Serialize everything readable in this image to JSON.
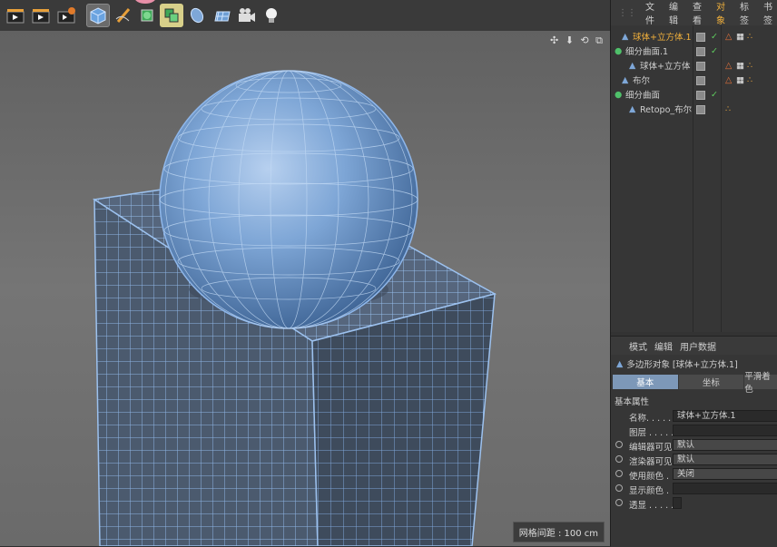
{
  "object_manager": {
    "menu": [
      "文件",
      "编辑",
      "查看",
      "对象",
      "标签",
      "书签"
    ],
    "active_menu": "对象",
    "objects": [
      {
        "name": "球体+立方体.1",
        "icon": "polygon-object-icon",
        "selected": true,
        "visible": "check",
        "tags": [
          "phong-tag-icon",
          "checker-tag-icon",
          "dots-tag-icon"
        ]
      },
      {
        "name": "细分曲面.1",
        "icon": "subdivision-surface-icon",
        "selected": false,
        "visible": "check",
        "tags": []
      },
      {
        "name": "球体+立方体",
        "icon": "polygon-object-icon",
        "selected": false,
        "visible": "",
        "tags": [
          "phong-tag-icon",
          "checker-tag-icon",
          "dots-tag-icon"
        ]
      },
      {
        "name": "布尔",
        "icon": "boole-icon",
        "selected": false,
        "visible": "",
        "tags": [
          "phong-tag-icon",
          "checker-tag-icon",
          "dots-tag-icon"
        ]
      },
      {
        "name": "细分曲面",
        "icon": "subdivision-surface-icon",
        "selected": false,
        "visible": "check",
        "tags": []
      },
      {
        "name": "Retopo_布尔",
        "icon": "polygon-object-icon",
        "selected": false,
        "visible": "",
        "tags": [
          "dots-tag-icon"
        ]
      }
    ]
  },
  "attributes": {
    "menu": [
      "模式",
      "编辑",
      "用户数据"
    ],
    "title": "多边形对象 [球体+立方体.1]",
    "tabs": [
      "基本",
      "坐标",
      "平滑着色"
    ],
    "active_tab": "基本",
    "section": "基本属性",
    "props": [
      {
        "label": "名称. . . . . .",
        "value": "球体+立方体.1",
        "radio": false
      },
      {
        "label": "图层 . . . . . .",
        "value": "",
        "radio": false
      },
      {
        "label": "编辑器可见",
        "value": "默认",
        "radio": true
      },
      {
        "label": "渲染器可见",
        "value": "默认",
        "radio": true
      },
      {
        "label": "使用颜色 . .",
        "value": "关闭",
        "radio": true
      },
      {
        "label": "显示颜色 . .",
        "value": "",
        "radio": true
      },
      {
        "label": "透显 . . . . . .",
        "value": "",
        "radio": true
      }
    ]
  },
  "viewport": {
    "status": "网格间距 : 100 cm",
    "nav_icons": "✣ ⬇ ⟲ ⧉"
  },
  "colors": {
    "accent": "#f2b13c",
    "mesh": "#5b8fd8",
    "viewport_bg": "#6c6c6c"
  }
}
